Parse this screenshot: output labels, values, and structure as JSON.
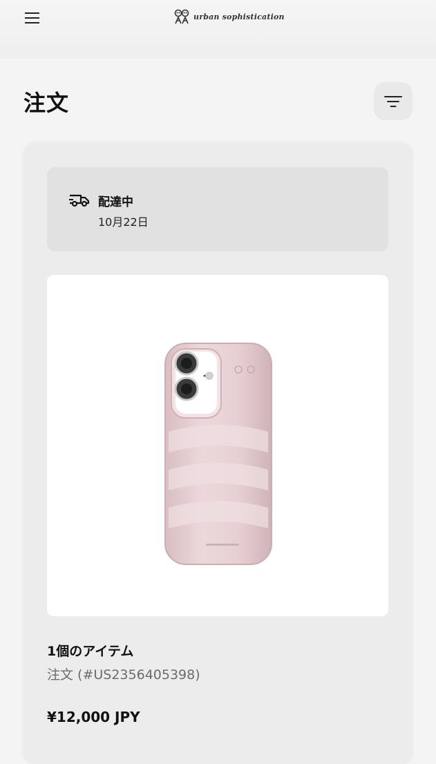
{
  "header": {
    "brand_name": "urban sophistication",
    "menu_icon": "hamburger-menu-icon",
    "logo_icon": "brand-logo-icon"
  },
  "page": {
    "title": "注文",
    "filter_icon": "filter-icon"
  },
  "order": {
    "status": {
      "icon": "delivery-truck-icon",
      "label": "配達中",
      "date": "10月22日"
    },
    "product_image": "pink-puffer-phone-case",
    "items_count": "1個のアイテム",
    "order_number": "注文 (#US2356405398)",
    "price": "¥12,000 JPY"
  },
  "colors": {
    "background": "#f4f4f4",
    "card": "#ececec",
    "status_box": "#e1e1e1",
    "product_case": "#e7cfd3"
  }
}
